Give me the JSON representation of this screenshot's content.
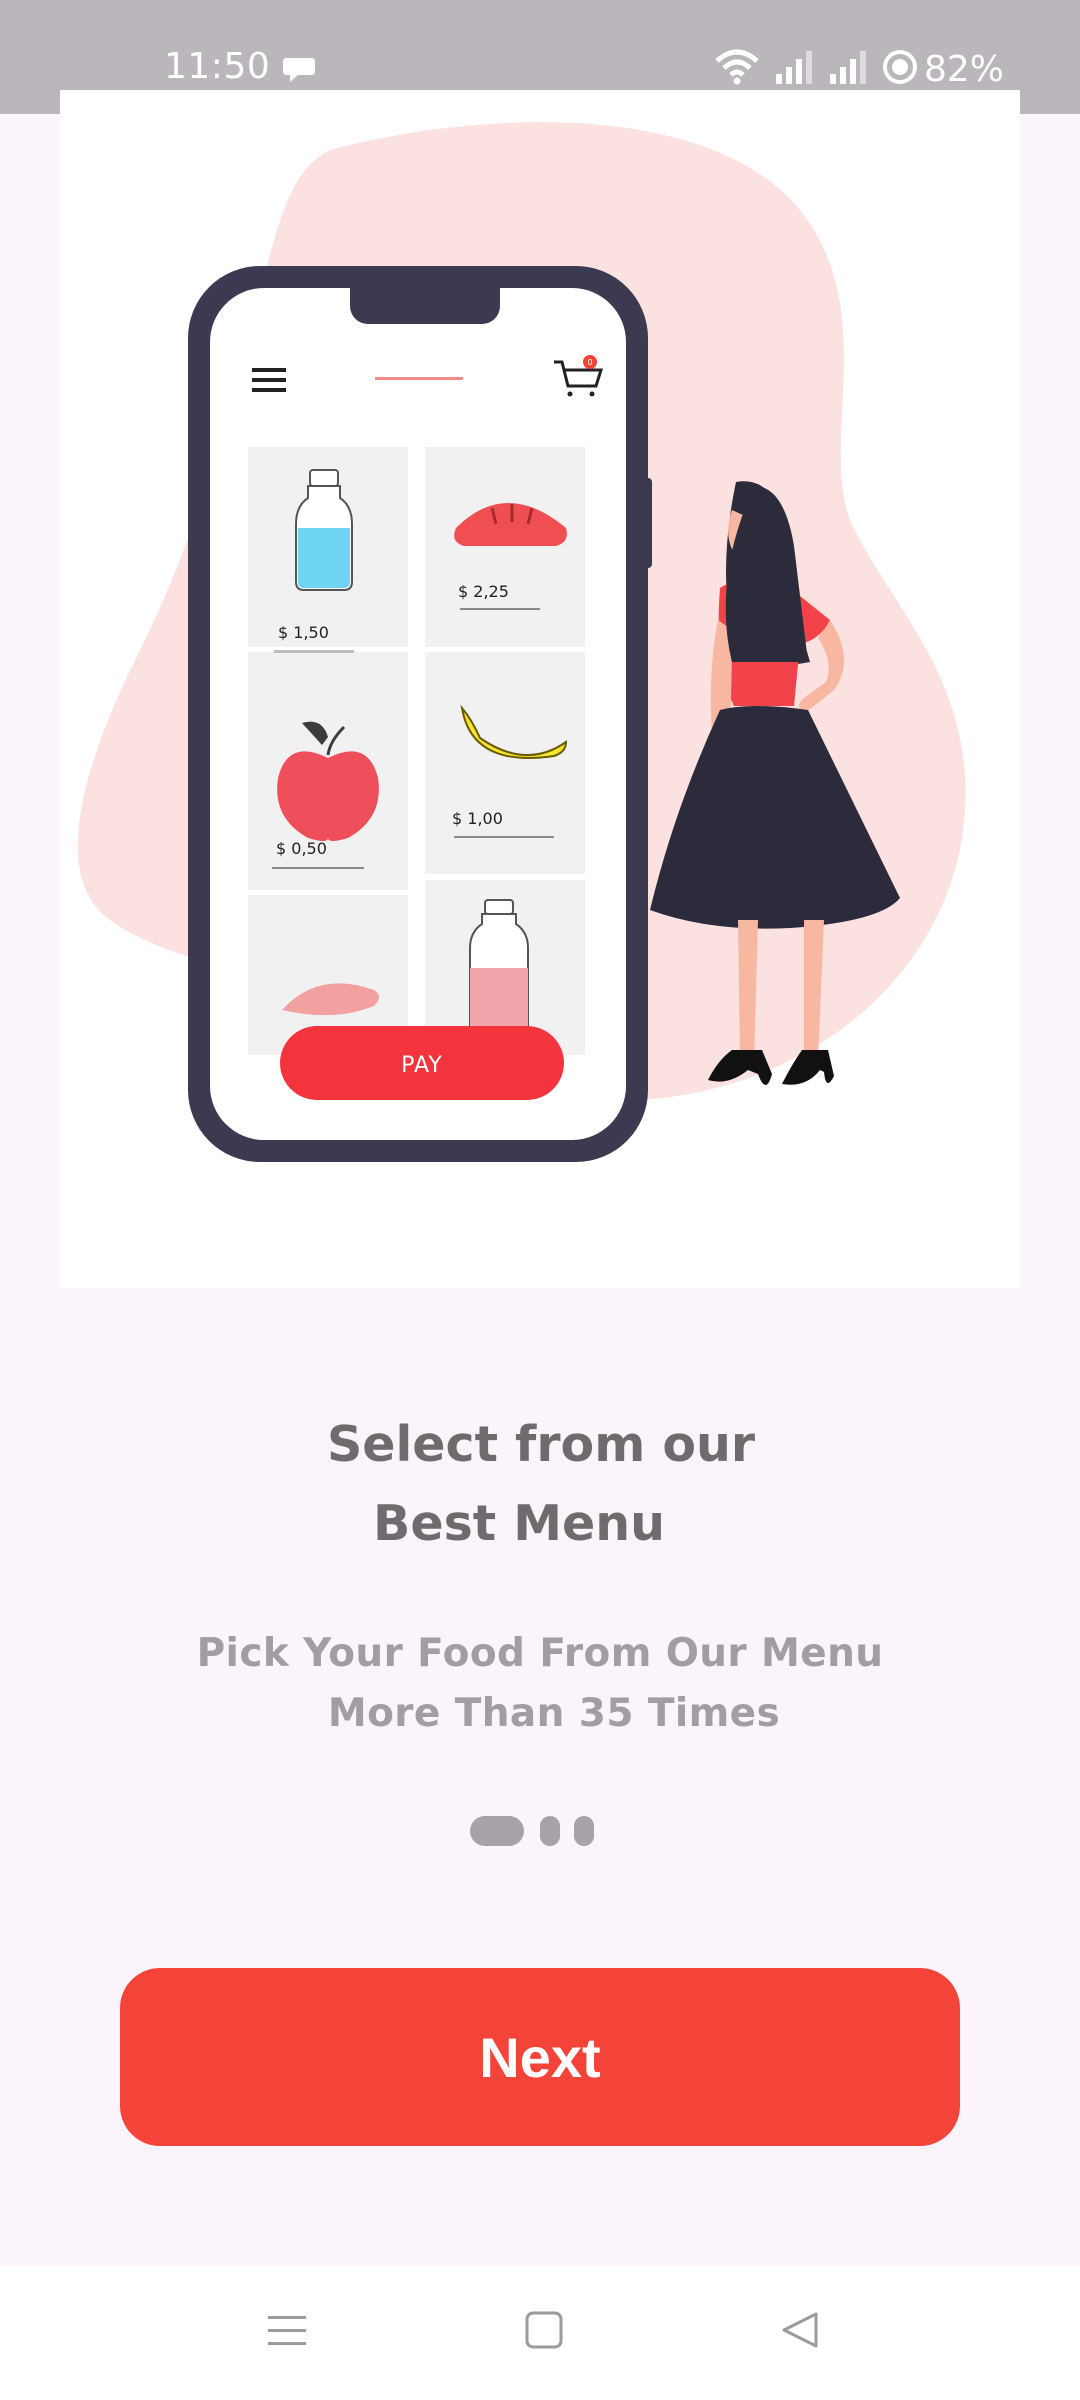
{
  "status_bar": {
    "time": "11:50",
    "battery": "82%",
    "icons": [
      "message-icon",
      "wifi-icon",
      "signal-icon",
      "signal-icon",
      "battery-icon"
    ]
  },
  "hero_illustration": {
    "prices": [
      "$ 1,50",
      "$ 2,25",
      "$ 0,50",
      "$ 1,00"
    ],
    "pay_label": "PAY",
    "cart_badge": "0"
  },
  "onboarding": {
    "title_line1": "Select from our",
    "title_line2": "Best Menu",
    "subtitle_line1": "Pick Your Food From Our Menu",
    "subtitle_line2": "More Than 35 Times",
    "page_index": 1,
    "page_count": 3,
    "next_label": "Next"
  },
  "colors": {
    "accent": "#f44338",
    "title": "#6f6a6e",
    "subtitle": "#a19da2",
    "background": "#fbf5fb"
  },
  "nav_bar": {
    "icons": [
      "menu-icon",
      "home-icon",
      "back-icon"
    ]
  }
}
